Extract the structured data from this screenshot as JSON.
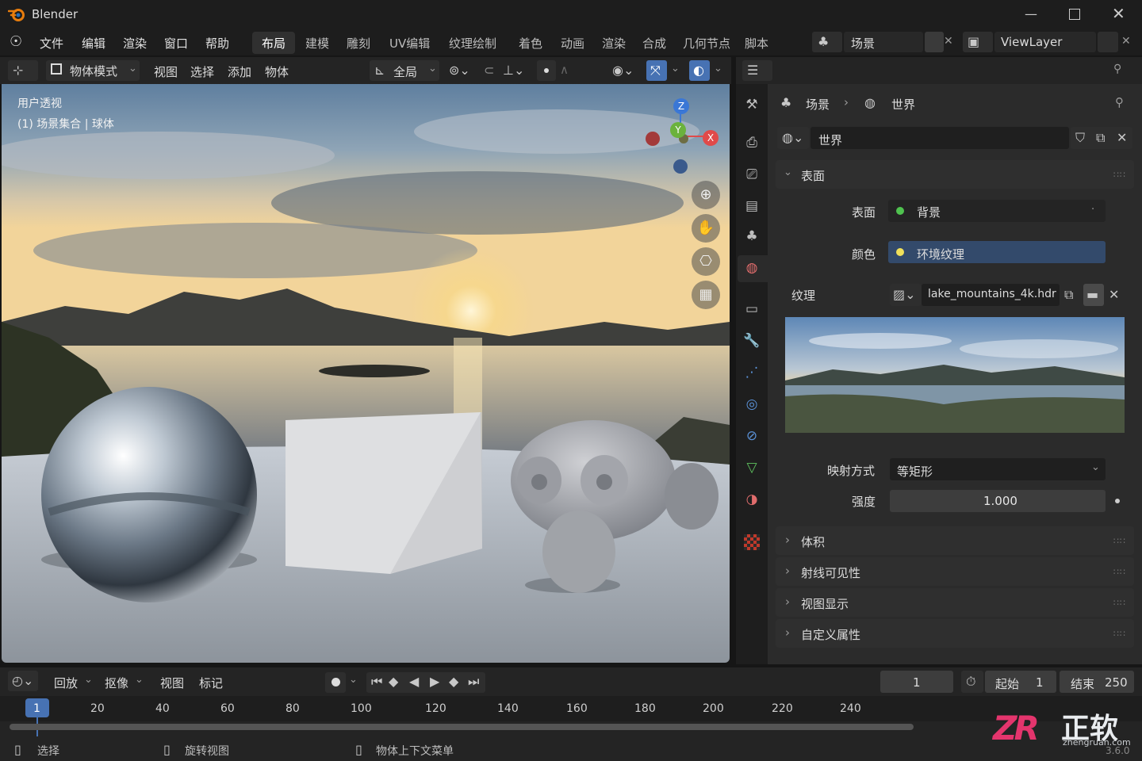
{
  "app": {
    "title": "Blender",
    "version": "3.6.0"
  },
  "menu": [
    "文件",
    "编辑",
    "渲染",
    "窗口",
    "帮助"
  ],
  "workspaces": [
    "布局",
    "建模",
    "雕刻",
    "UV编辑",
    "纹理绘制",
    "着色",
    "动画",
    "渲染",
    "合成",
    "几何节点",
    "脚本"
  ],
  "scene_field": "场景",
  "viewlayer_field": "ViewLayer",
  "viewport_header": {
    "mode": "物体模式",
    "menus": [
      "视图",
      "选择",
      "添加",
      "物体"
    ],
    "transform": "全局"
  },
  "viewport_overlay": {
    "line1": "用户透视",
    "line2": "(1) 场景集合 | 球体"
  },
  "gizmo": {
    "x": "X",
    "y": "Y",
    "z": "Z"
  },
  "props": {
    "breadcrumb_scene": "场景",
    "breadcrumb_world": "世界",
    "world_name": "世界",
    "surface_section": "表面",
    "surface_label": "表面",
    "surface_value": "背景",
    "color_label": "颜色",
    "color_value": "环境纹理",
    "texture_label": "纹理",
    "texture_file": "lake_mountains_4k.hdr",
    "projection_label": "映射方式",
    "projection_value": "等矩形",
    "strength_label": "强度",
    "strength_value": "1.000",
    "collapsed_sections": [
      "体积",
      "射线可见性",
      "视图显示",
      "自定义属性"
    ]
  },
  "timeline": {
    "menus": [
      "回放",
      "抠像",
      "视图",
      "标记"
    ],
    "current_frame": "1",
    "start_label": "起始",
    "start_value": "1",
    "end_label": "结束",
    "end_value": "250",
    "ticks": [
      "1",
      "20",
      "40",
      "60",
      "80",
      "100",
      "120",
      "140",
      "160",
      "180",
      "200",
      "220",
      "240"
    ]
  },
  "statusbar": {
    "select": "选择",
    "rotate": "旋转视图",
    "context": "物体上下文菜单"
  },
  "watermark": {
    "brand": "正软",
    "site": "zhengruan.com"
  },
  "colors": {
    "accent": "#4772b3",
    "panel": "#2b2b2b",
    "header": "#242424",
    "surface_dot": "#4fc24f",
    "color_dot": "#f0e05a"
  }
}
